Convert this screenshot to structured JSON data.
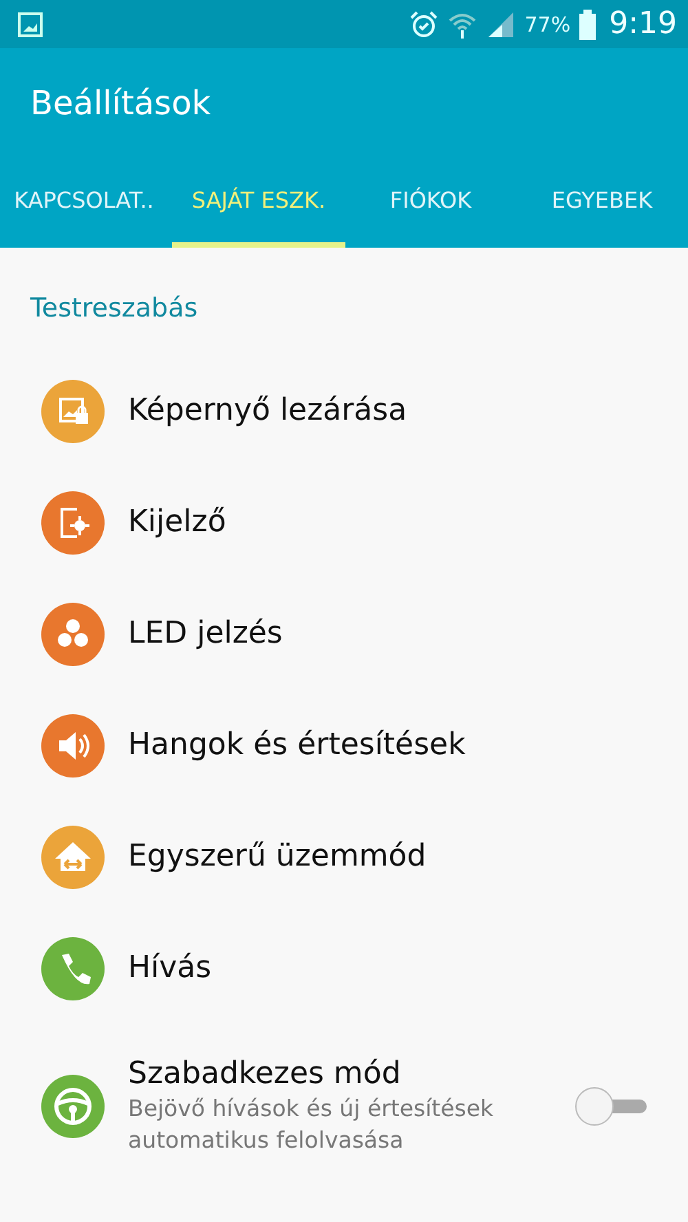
{
  "status_bar": {
    "battery": "77%",
    "time": "9:19"
  },
  "app_bar": {
    "title": "Beállítások"
  },
  "tabs": [
    {
      "label": "KAPCSOLAT..",
      "selected": false
    },
    {
      "label": "SAJÁT ESZK.",
      "selected": true
    },
    {
      "label": "FIÓKOK",
      "selected": false
    },
    {
      "label": "EGYEBEK",
      "selected": false
    }
  ],
  "section": {
    "title": "Testreszabás"
  },
  "items": [
    {
      "title": "Képernyő lezárása",
      "color": "#eba43a"
    },
    {
      "title": "Kijelző",
      "color": "#e8772e"
    },
    {
      "title": "LED jelzés",
      "color": "#e8772e"
    },
    {
      "title": "Hangok és értesítések",
      "color": "#e8772e"
    },
    {
      "title": "Egyszerű üzemmód",
      "color": "#eba43a"
    },
    {
      "title": "Hívás",
      "color": "#6cb33f"
    },
    {
      "title": "Szabadkezes mód",
      "subtitle": "Bejövő hívások és új értesítések automatikus felolvasása",
      "color": "#6cb33f",
      "kind": "toggle",
      "on": false
    }
  ]
}
